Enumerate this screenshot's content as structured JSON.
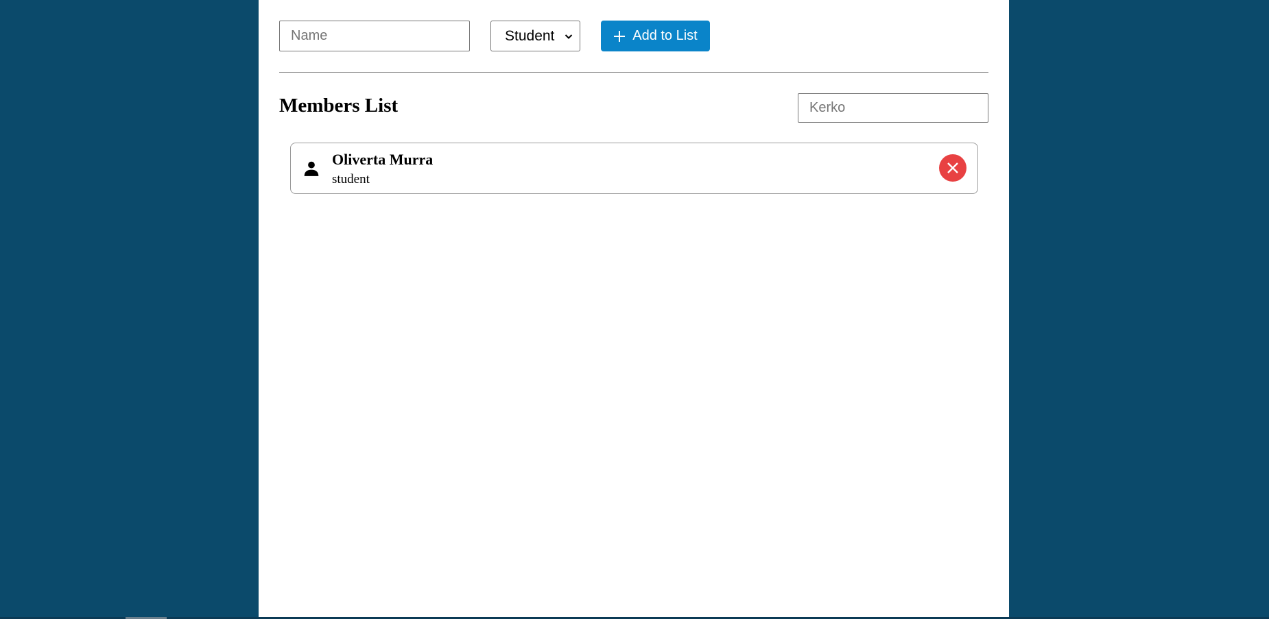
{
  "form": {
    "name_placeholder": "Name",
    "role_selected": "Student",
    "add_button_label": "Add to List",
    "add_icon": "plus-icon"
  },
  "members_section": {
    "title": "Members List",
    "search_value": "Kerko",
    "members": [
      {
        "name": "Oliverta Murra",
        "role": "student",
        "icon": "person-icon",
        "remove_icon": "close-icon"
      }
    ]
  },
  "colors": {
    "background": "#0b4a6b",
    "panel": "#ffffff",
    "accent_button": "#0a84c9",
    "remove_button": "#e84142"
  }
}
